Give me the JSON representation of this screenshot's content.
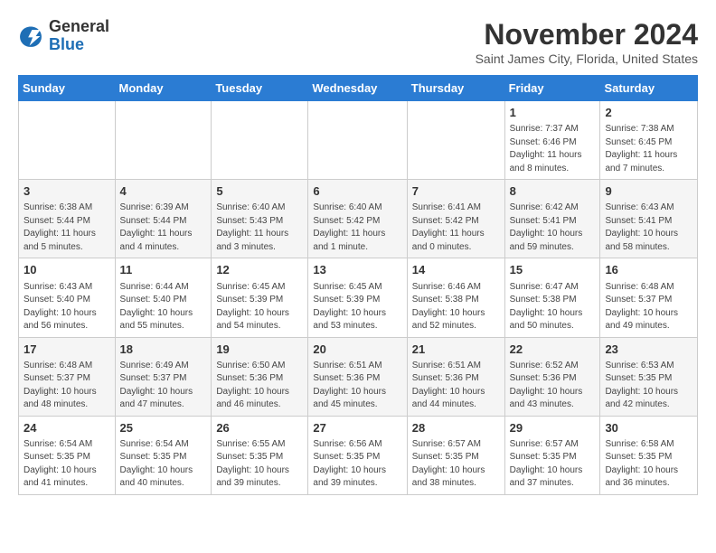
{
  "logo": {
    "general": "General",
    "blue": "Blue"
  },
  "header": {
    "month": "November 2024",
    "location": "Saint James City, Florida, United States"
  },
  "weekdays": [
    "Sunday",
    "Monday",
    "Tuesday",
    "Wednesday",
    "Thursday",
    "Friday",
    "Saturday"
  ],
  "weeks": [
    [
      {
        "day": "",
        "info": ""
      },
      {
        "day": "",
        "info": ""
      },
      {
        "day": "",
        "info": ""
      },
      {
        "day": "",
        "info": ""
      },
      {
        "day": "",
        "info": ""
      },
      {
        "day": "1",
        "info": "Sunrise: 7:37 AM\nSunset: 6:46 PM\nDaylight: 11 hours and 8 minutes."
      },
      {
        "day": "2",
        "info": "Sunrise: 7:38 AM\nSunset: 6:45 PM\nDaylight: 11 hours and 7 minutes."
      }
    ],
    [
      {
        "day": "3",
        "info": "Sunrise: 6:38 AM\nSunset: 5:44 PM\nDaylight: 11 hours and 5 minutes."
      },
      {
        "day": "4",
        "info": "Sunrise: 6:39 AM\nSunset: 5:44 PM\nDaylight: 11 hours and 4 minutes."
      },
      {
        "day": "5",
        "info": "Sunrise: 6:40 AM\nSunset: 5:43 PM\nDaylight: 11 hours and 3 minutes."
      },
      {
        "day": "6",
        "info": "Sunrise: 6:40 AM\nSunset: 5:42 PM\nDaylight: 11 hours and 1 minute."
      },
      {
        "day": "7",
        "info": "Sunrise: 6:41 AM\nSunset: 5:42 PM\nDaylight: 11 hours and 0 minutes."
      },
      {
        "day": "8",
        "info": "Sunrise: 6:42 AM\nSunset: 5:41 PM\nDaylight: 10 hours and 59 minutes."
      },
      {
        "day": "9",
        "info": "Sunrise: 6:43 AM\nSunset: 5:41 PM\nDaylight: 10 hours and 58 minutes."
      }
    ],
    [
      {
        "day": "10",
        "info": "Sunrise: 6:43 AM\nSunset: 5:40 PM\nDaylight: 10 hours and 56 minutes."
      },
      {
        "day": "11",
        "info": "Sunrise: 6:44 AM\nSunset: 5:40 PM\nDaylight: 10 hours and 55 minutes."
      },
      {
        "day": "12",
        "info": "Sunrise: 6:45 AM\nSunset: 5:39 PM\nDaylight: 10 hours and 54 minutes."
      },
      {
        "day": "13",
        "info": "Sunrise: 6:45 AM\nSunset: 5:39 PM\nDaylight: 10 hours and 53 minutes."
      },
      {
        "day": "14",
        "info": "Sunrise: 6:46 AM\nSunset: 5:38 PM\nDaylight: 10 hours and 52 minutes."
      },
      {
        "day": "15",
        "info": "Sunrise: 6:47 AM\nSunset: 5:38 PM\nDaylight: 10 hours and 50 minutes."
      },
      {
        "day": "16",
        "info": "Sunrise: 6:48 AM\nSunset: 5:37 PM\nDaylight: 10 hours and 49 minutes."
      }
    ],
    [
      {
        "day": "17",
        "info": "Sunrise: 6:48 AM\nSunset: 5:37 PM\nDaylight: 10 hours and 48 minutes."
      },
      {
        "day": "18",
        "info": "Sunrise: 6:49 AM\nSunset: 5:37 PM\nDaylight: 10 hours and 47 minutes."
      },
      {
        "day": "19",
        "info": "Sunrise: 6:50 AM\nSunset: 5:36 PM\nDaylight: 10 hours and 46 minutes."
      },
      {
        "day": "20",
        "info": "Sunrise: 6:51 AM\nSunset: 5:36 PM\nDaylight: 10 hours and 45 minutes."
      },
      {
        "day": "21",
        "info": "Sunrise: 6:51 AM\nSunset: 5:36 PM\nDaylight: 10 hours and 44 minutes."
      },
      {
        "day": "22",
        "info": "Sunrise: 6:52 AM\nSunset: 5:36 PM\nDaylight: 10 hours and 43 minutes."
      },
      {
        "day": "23",
        "info": "Sunrise: 6:53 AM\nSunset: 5:35 PM\nDaylight: 10 hours and 42 minutes."
      }
    ],
    [
      {
        "day": "24",
        "info": "Sunrise: 6:54 AM\nSunset: 5:35 PM\nDaylight: 10 hours and 41 minutes."
      },
      {
        "day": "25",
        "info": "Sunrise: 6:54 AM\nSunset: 5:35 PM\nDaylight: 10 hours and 40 minutes."
      },
      {
        "day": "26",
        "info": "Sunrise: 6:55 AM\nSunset: 5:35 PM\nDaylight: 10 hours and 39 minutes."
      },
      {
        "day": "27",
        "info": "Sunrise: 6:56 AM\nSunset: 5:35 PM\nDaylight: 10 hours and 39 minutes."
      },
      {
        "day": "28",
        "info": "Sunrise: 6:57 AM\nSunset: 5:35 PM\nDaylight: 10 hours and 38 minutes."
      },
      {
        "day": "29",
        "info": "Sunrise: 6:57 AM\nSunset: 5:35 PM\nDaylight: 10 hours and 37 minutes."
      },
      {
        "day": "30",
        "info": "Sunrise: 6:58 AM\nSunset: 5:35 PM\nDaylight: 10 hours and 36 minutes."
      }
    ]
  ]
}
